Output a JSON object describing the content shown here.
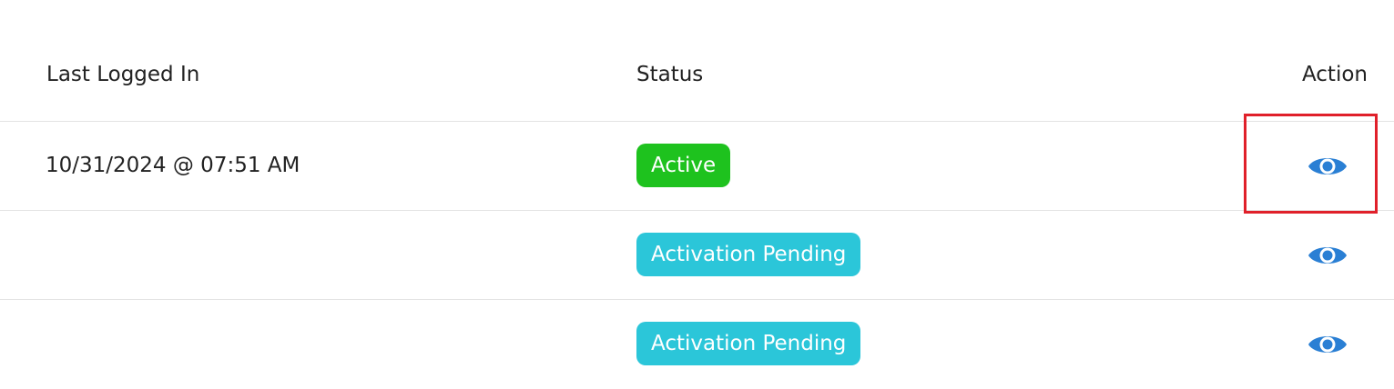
{
  "table": {
    "headers": {
      "last_logged_in": "Last Logged In",
      "status": "Status",
      "action": "Action"
    },
    "rows": [
      {
        "last_logged_in": "10/31/2024 @ 07:51 AM",
        "status": "Active",
        "status_color": "#1ec21e",
        "action_icon": "eye-icon"
      },
      {
        "last_logged_in": "",
        "status": "Activation Pending",
        "status_color": "#2bc6d9",
        "action_icon": "eye-icon"
      },
      {
        "last_logged_in": "",
        "status": "Activation Pending",
        "status_color": "#2bc6d9",
        "action_icon": "eye-icon"
      }
    ]
  },
  "colors": {
    "eye_icon": "#2a7fd4",
    "highlight_box": "#e0202a",
    "row_divider": "#e3e3e3",
    "text": "#222222"
  }
}
